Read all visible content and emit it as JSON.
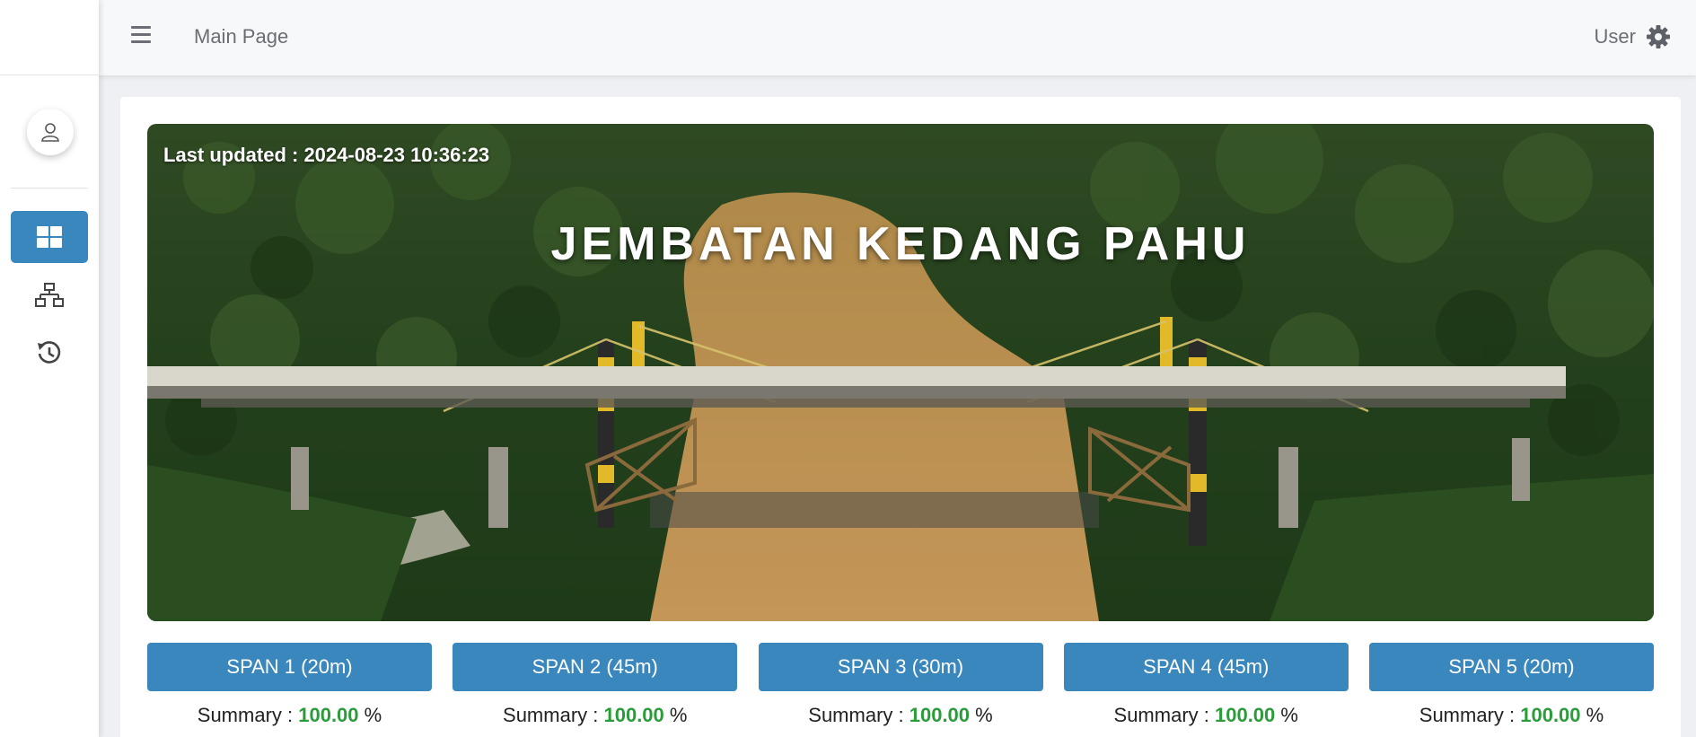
{
  "header": {
    "page_title": "Main Page",
    "user_label": "User"
  },
  "sidebar": {
    "items": [
      {
        "name": "dashboard",
        "icon": "dashboard-grid-icon",
        "active": true
      },
      {
        "name": "network",
        "icon": "sitemap-icon",
        "active": false
      },
      {
        "name": "history",
        "icon": "history-icon",
        "active": false
      }
    ]
  },
  "hero": {
    "last_updated_label": "Last updated : 2024-08-23 10:36:23",
    "title": "JEMBATAN KEDANG PAHU"
  },
  "spans": [
    {
      "label": "SPAN 1 (20m)",
      "summary_prefix": "Summary : ",
      "summary_value": "100.00",
      "summary_suffix": " %"
    },
    {
      "label": "SPAN 2 (45m)",
      "summary_prefix": "Summary : ",
      "summary_value": "100.00",
      "summary_suffix": " %"
    },
    {
      "label": "SPAN 3 (30m)",
      "summary_prefix": "Summary : ",
      "summary_value": "100.00",
      "summary_suffix": " %"
    },
    {
      "label": "SPAN 4 (45m)",
      "summary_prefix": "Summary : ",
      "summary_value": "100.00",
      "summary_suffix": " %"
    },
    {
      "label": "SPAN 5 (20m)",
      "summary_prefix": "Summary : ",
      "summary_value": "100.00",
      "summary_suffix": " %"
    }
  ],
  "colors": {
    "accent": "#3a87bd",
    "success": "#2a9d3a",
    "header_bg": "#f7f8fa",
    "page_bg": "#eef0f3"
  }
}
